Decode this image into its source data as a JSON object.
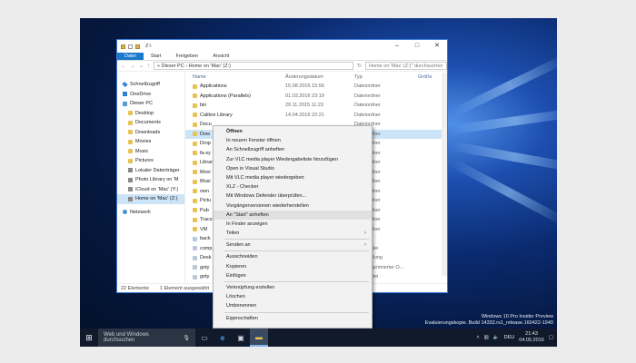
{
  "window": {
    "title": "Z:\\",
    "ribbon_tabs": [
      "Datei",
      "Start",
      "Freigeben",
      "Ansicht"
    ],
    "address_path": "« Dieser PC  ›  Home on 'Mac' (Z:)",
    "search_placeholder": "Home on 'Mac' (Z:)\" durchsuchen",
    "columns": {
      "name": "Name",
      "date": "Änderungsdatum",
      "type": "Typ",
      "size": "Größe"
    }
  },
  "navpane": [
    {
      "label": "Schnellzugriff",
      "icon": "star-icon",
      "sub": false
    },
    {
      "label": "OneDrive",
      "icon": "cloud-icon",
      "sub": false
    },
    {
      "label": "Dieser PC",
      "icon": "computer-icon",
      "sub": false
    },
    {
      "label": "Desktop",
      "icon": "folder-icon",
      "sub": true
    },
    {
      "label": "Documents",
      "icon": "folder-icon",
      "sub": true
    },
    {
      "label": "Downloads",
      "icon": "folder-icon",
      "sub": true
    },
    {
      "label": "Movies",
      "icon": "folder-icon",
      "sub": true
    },
    {
      "label": "Music",
      "icon": "folder-icon",
      "sub": true
    },
    {
      "label": "Pictures",
      "icon": "folder-icon",
      "sub": true
    },
    {
      "label": "Lokaler Datenträger",
      "icon": "drive-icon",
      "sub": true
    },
    {
      "label": "Photo Library on 'M",
      "icon": "drive-icon",
      "sub": true
    },
    {
      "label": "iCloud on 'Mac' (Y:)",
      "icon": "drive-icon",
      "sub": true
    },
    {
      "label": "Home on 'Mac' (Z:)",
      "icon": "drive-icon",
      "sub": true,
      "selected": true
    },
    {
      "label": "Netzwerk",
      "icon": "network-icon",
      "sub": false
    }
  ],
  "files": [
    {
      "name": "Applications",
      "date": "15.08.2016 15:56",
      "type": "Dateiordner"
    },
    {
      "name": "Applications (Parallels)",
      "date": "01.03.2016 23:19",
      "type": "Dateiordner"
    },
    {
      "name": "bin",
      "date": "29.11.2015 11:23",
      "type": "Dateiordner"
    },
    {
      "name": "Calibre Library",
      "date": "14.04.2016 22:21",
      "type": "Dateiordner"
    },
    {
      "name": "Docu",
      "date": "",
      "type": "Dateiordner"
    },
    {
      "name": "Dow",
      "date": "",
      "type": "Dateiordner",
      "selected": true
    },
    {
      "name": "Drop",
      "date": "",
      "type": "Dateiordner"
    },
    {
      "name": "fa-sy",
      "date": "",
      "type": "Dateiordner"
    },
    {
      "name": "Librar",
      "date": "",
      "type": "Dateiordner"
    },
    {
      "name": "Movi",
      "date": "",
      "type": "Dateiordner"
    },
    {
      "name": "Musi",
      "date": "",
      "type": "Dateiordner"
    },
    {
      "name": "own",
      "date": "",
      "type": "Dateiordner"
    },
    {
      "name": "Pictu",
      "date": "",
      "type": "Dateiordner"
    },
    {
      "name": "Pub",
      "date": "",
      "type": "Dateiordner"
    },
    {
      "name": "Tracs",
      "date": "",
      "type": "Dateiordner"
    },
    {
      "name": "VM",
      "date": "",
      "type": "Dateiordner"
    },
    {
      "name": "back",
      "date": "",
      "type": "Datei"
    },
    {
      "name": "comp",
      "date": "",
      "type": "RAR-Datei"
    },
    {
      "name": "Desk",
      "date": "",
      "type": "Verknüpfung"
    },
    {
      "name": "goty",
      "date": "",
      "type": "ZIP-komprimierter O..."
    },
    {
      "name": "goty",
      "date": "",
      "type": "RAR-Datei"
    }
  ],
  "status": {
    "count": "22 Elemente",
    "selection": "1 Element ausgewählt"
  },
  "context_menu": {
    "items": [
      {
        "label": "Öffnen",
        "bold": true
      },
      {
        "label": "In neuem Fenster öffnen"
      },
      {
        "label": "An Schnellzugriff anheften"
      },
      {
        "label": "Zur VLC media player Wiedergabeliste hinzufügen"
      },
      {
        "label": "Open in Visual Studio"
      },
      {
        "label": "Mit VLC media player wiedergeben"
      },
      {
        "label": "XLZ - Checker"
      },
      {
        "label": "Mit Windows Defender überprüfen..."
      },
      {
        "label": "Vorgängerversionen wiederherstellen"
      },
      {
        "label": "An \"Start\" anheften",
        "highlight": true
      },
      {
        "label": "In Finder anzeigen"
      },
      {
        "label": "Teilen",
        "submenu": true
      },
      {
        "separator": true
      },
      {
        "label": "Senden an",
        "submenu": true
      },
      {
        "separator": true
      },
      {
        "label": "Ausschneiden"
      },
      {
        "label": "Kopieren"
      },
      {
        "label": "Einfügen"
      },
      {
        "separator": true
      },
      {
        "label": "Verknüpfung erstellen"
      },
      {
        "label": "Löschen"
      },
      {
        "label": "Umbenennen"
      },
      {
        "separator": true
      },
      {
        "label": "Eigenschaften"
      }
    ]
  },
  "watermark": {
    "line1": "Windows 10 Pro Insider Preview",
    "line2": "Evaluierungskopie. Build 14332.rs1_release.160422-1940"
  },
  "taskbar": {
    "search_text": "Web und Windows durchsuchen",
    "tray_lang": "DEU",
    "time": "21:43",
    "date": "04.05.2016"
  },
  "colors": {
    "accent": "#1979ca",
    "selection": "#cce4f7"
  }
}
